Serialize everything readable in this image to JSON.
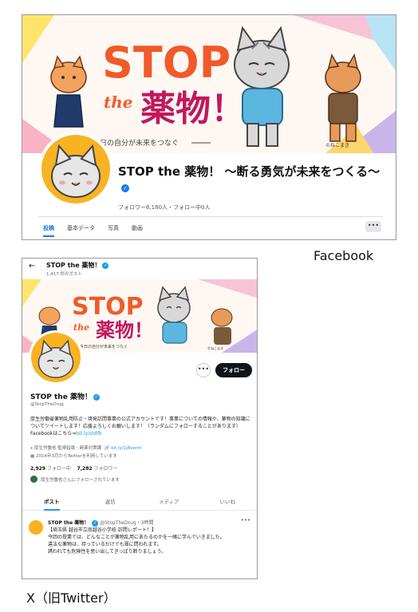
{
  "facebook": {
    "cover": {
      "stop": "STOP",
      "the": "the",
      "drugs": "薬物！",
      "tagline": "今日の自分が未来をつなぐ",
      "credit": "©ねこまき"
    },
    "page_name": "STOP the 薬物！ 〜断る勇気が未来をつくる〜",
    "verified_icon": "verified-badge",
    "followers": "フォロワー6,180人・フォロー中0人",
    "tabs": [
      "投稿",
      "基本データ",
      "写真",
      "動画"
    ],
    "active_tab": "投稿",
    "more": "•••",
    "caption": "Facebook",
    "accent": "#1877f2"
  },
  "x": {
    "back": "←",
    "title": "STOP the 薬物！",
    "post_count": "1,417 件のポスト",
    "cover": {
      "stop": "STOP",
      "the": "the",
      "drugs": "薬物！",
      "tagline": "今日の自分が未来をつなぐ",
      "credit": "©ねこまき"
    },
    "more_button": "•••",
    "follow_button": "フォロー",
    "name": "STOP the 薬物！",
    "handle": "@StopTheDrug",
    "bio": "厚生労働省薬物乱用防止・啓発訪問事業の公式アカウントです！事業についての情報や、薬物の知識についてツイートします！応援よろしくお願いします！（ランダムにフォローすることがあります）Facebookはこちら⇒",
    "bio_link": "bit.ly/stdfb",
    "meta_org": "厚生労働省 監視指導・麻薬対策課",
    "meta_link": "bit.ly/1j8vemt",
    "joined": "2014年3月からTwitterを利用しています",
    "following_count": "2,929",
    "following_label": "フォロー中",
    "followers_count": "7,282",
    "followers_label": "フォロワー",
    "followed_by": "厚生労働省さんにフォローされています",
    "tabs": [
      "ポスト",
      "返信",
      "メディア",
      "いいね"
    ],
    "active_tab": "ポスト",
    "post": {
      "author": "STOP the 薬物！",
      "meta": "@StopTheDrug・3時間",
      "more": "•••",
      "lines": [
        "【埼玉県 越谷市立南越谷小学校 訪問レポート！】",
        "今回の授業では、どんなことが薬物乱用にあたるのかを一緒に学んでいきました。",
        "違法な薬物は、持っているだけでも罪に問われます。",
        "誘われても危険性を思い出してきっぱり断りましょう。"
      ]
    },
    "caption": "X（旧Twitter）",
    "accent": "#1d9bf0"
  }
}
